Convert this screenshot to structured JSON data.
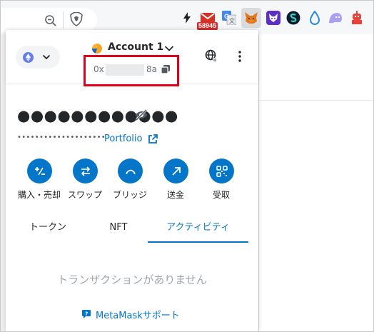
{
  "browser": {
    "icons": [
      "zoom-out-icon",
      "brave-shield-icon",
      "bolt-extension-icon",
      "gmail-extension-icon",
      "google-translate-extension-icon",
      "metamask-extension-icon",
      "fox-extension-icon",
      "s-extension-icon",
      "drop-extension-icon",
      "ghost-extension-icon",
      "robot-extension-icon"
    ],
    "gmail_badge": "58945"
  },
  "header": {
    "account_name": "Account 1",
    "address_prefix": "0x",
    "address_suffix": "8a",
    "network_color": "#627eea"
  },
  "balance": {
    "hidden_balance": "●●●●●●●●●●●●",
    "hidden_fiat": "••••••••••••••••••••",
    "portfolio_label": "Portfolio"
  },
  "actions": [
    {
      "label": "購入・売却",
      "icon": "plus-minus-icon"
    },
    {
      "label": "スワップ",
      "icon": "swap-arrows-icon"
    },
    {
      "label": "ブリッジ",
      "icon": "bridge-icon"
    },
    {
      "label": "送金",
      "icon": "send-arrow-icon"
    },
    {
      "label": "受取",
      "icon": "qr-code-icon"
    }
  ],
  "tabs": [
    {
      "label": "トークン",
      "active": false
    },
    {
      "label": "NFT",
      "active": false
    },
    {
      "label": "アクティビティ",
      "active": true
    }
  ],
  "activity": {
    "empty_message": "トランザクションがありません",
    "support_link": "MetaMaskサポート"
  },
  "colors": {
    "accent": "#0376c9",
    "highlight": "#e0001b"
  }
}
